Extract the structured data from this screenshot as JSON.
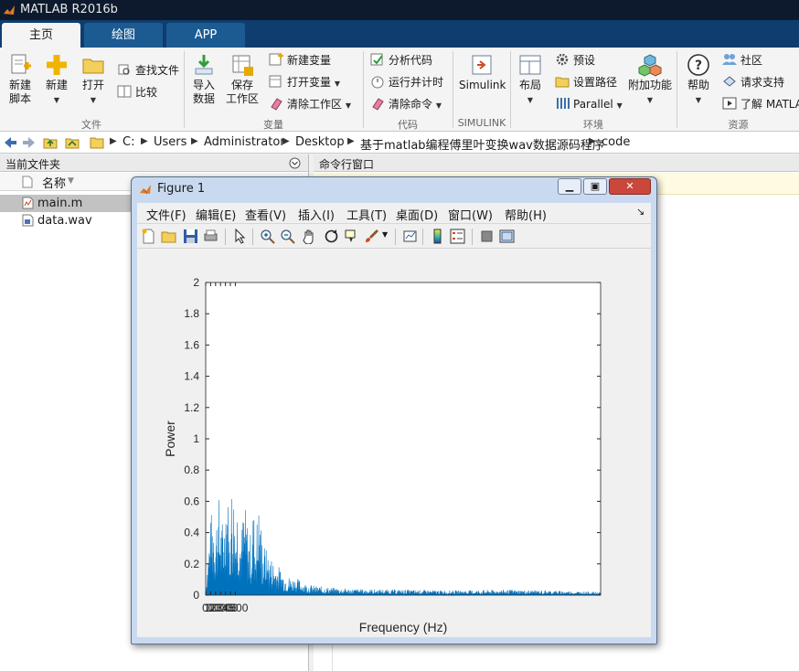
{
  "app": {
    "title": "MATLAB R2016b"
  },
  "tabs": [
    "主页",
    "绘图",
    "APP"
  ],
  "ribbon": {
    "file": {
      "new_script": [
        "新建",
        "脚本"
      ],
      "new": "新建",
      "open": "打开",
      "find_files": "查找文件",
      "compare": "比较",
      "group": "文件"
    },
    "variable": {
      "import": [
        "导入",
        "数据"
      ],
      "save": [
        "保存",
        "工作区"
      ],
      "new_var": "新建变量",
      "open_var": "打开变量",
      "clear_ws": "清除工作区",
      "group": "变量"
    },
    "code": {
      "analyze": "分析代码",
      "run_time": "运行并计时",
      "clear_cmds": "清除命令",
      "group": "代码"
    },
    "simulink": {
      "btn": "Simulink",
      "group": "SIMULINK"
    },
    "env": {
      "layout": "布局",
      "prefs": "预设",
      "set_path": "设置路径",
      "parallel": "Parallel",
      "addons": "附加功能",
      "group": "环境"
    },
    "resources": {
      "help": "帮助",
      "community": "社区",
      "support": "请求支持",
      "learn": "了解 MATLAB",
      "group": "资源"
    }
  },
  "path": [
    "C:",
    "Users",
    "Administrator",
    "Desktop",
    "基于matlab编程傅里叶变换wav数据源码程序",
    "code"
  ],
  "file_browser": {
    "title": "当前文件夹",
    "col_name": "名称",
    "files": [
      "main.m",
      "data.wav"
    ]
  },
  "command_window": {
    "title": "命令行窗口"
  },
  "figure": {
    "title": "Figure 1",
    "menus": [
      "文件(F)",
      "编辑(E)",
      "查看(V)",
      "插入(I)",
      "工具(T)",
      "桌面(D)",
      "窗口(W)",
      "帮助(H)"
    ]
  },
  "chart_data": {
    "type": "line",
    "xlabel": "Frequency (Hz)",
    "ylabel": "Power",
    "ylim": [
      0,
      2
    ],
    "yticks": [
      0,
      0.2,
      0.4,
      0.6,
      0.8,
      1,
      1.2,
      1.4,
      1.6,
      1.8,
      2
    ],
    "ytick_labels": [
      "0",
      "0.2",
      "0.4",
      "0.6",
      "0.8",
      "1",
      "1.2",
      "1.4",
      "1.6",
      "1.8",
      "2"
    ],
    "xlim": [
      0,
      8000
    ],
    "xtick_cluster_label": "0100200300400500",
    "xtick_label_600": "600",
    "color": "#0072bd",
    "envelope": [
      [
        0,
        0.0
      ],
      [
        40,
        0.25
      ],
      [
        80,
        0.45
      ],
      [
        120,
        0.55
      ],
      [
        160,
        0.62
      ],
      [
        200,
        0.5
      ],
      [
        260,
        0.66
      ],
      [
        320,
        0.48
      ],
      [
        380,
        0.52
      ],
      [
        420,
        0.9
      ],
      [
        480,
        0.42
      ],
      [
        540,
        0.85
      ],
      [
        600,
        0.55
      ],
      [
        660,
        0.72
      ],
      [
        720,
        0.4
      ],
      [
        780,
        0.62
      ],
      [
        840,
        0.5
      ],
      [
        900,
        0.38
      ],
      [
        960,
        0.58
      ],
      [
        1020,
        0.45
      ],
      [
        1080,
        0.62
      ],
      [
        1150,
        0.36
      ],
      [
        1250,
        0.28
      ],
      [
        1350,
        0.24
      ],
      [
        1450,
        0.2
      ],
      [
        1550,
        0.16
      ],
      [
        1700,
        0.12
      ],
      [
        1850,
        0.11
      ],
      [
        2000,
        0.08
      ],
      [
        2200,
        0.06
      ],
      [
        2500,
        0.05
      ],
      [
        3000,
        0.04
      ],
      [
        4000,
        0.035
      ],
      [
        5000,
        0.03
      ],
      [
        6000,
        0.035
      ],
      [
        7000,
        0.03
      ],
      [
        8000,
        0.02
      ]
    ]
  },
  "colors": {
    "title_bg": "#0d1a2e",
    "tab_bg": "#0f3d6e",
    "line": "#0072bd"
  }
}
